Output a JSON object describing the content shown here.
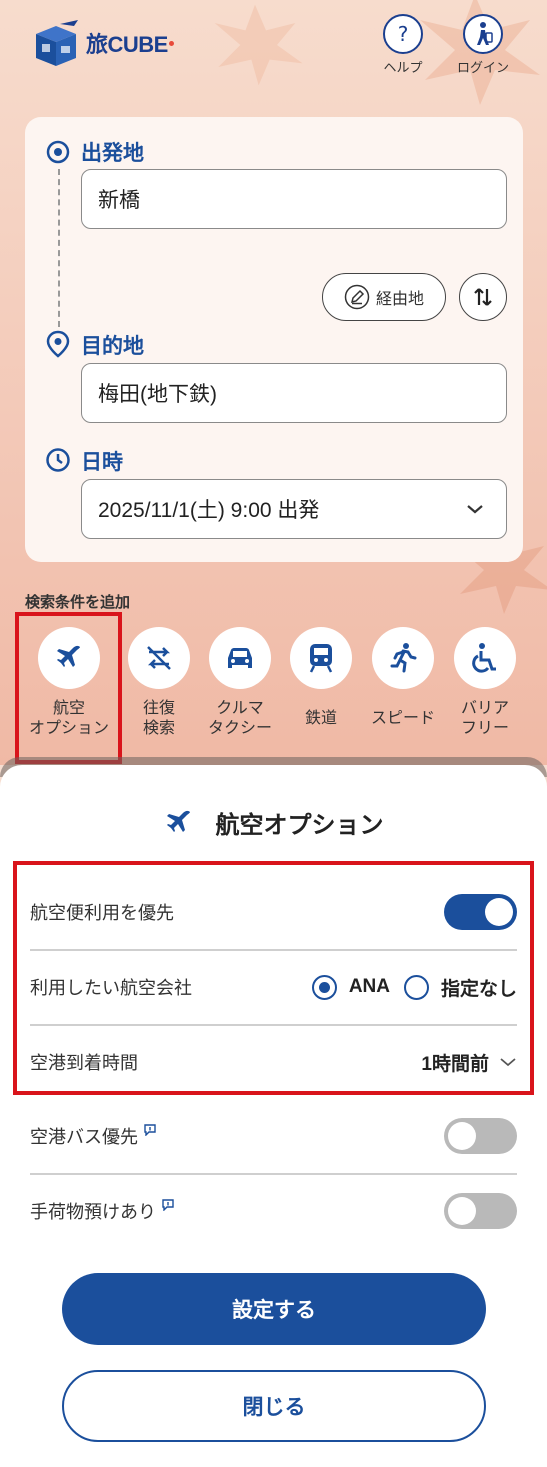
{
  "header": {
    "logo_text": "旅CUBE",
    "help_label": "ヘルプ",
    "login_label": "ログイン"
  },
  "search": {
    "origin_title": "出発地",
    "origin_value": "新橋",
    "via_label": "経由地",
    "destination_title": "目的地",
    "destination_value": "梅田(地下鉄)",
    "datetime_title": "日時",
    "datetime_value": "2025/11/1(土) 9:00 出発"
  },
  "conditions": {
    "title": "検索条件を追加",
    "options": [
      {
        "label": "航空\nオプション",
        "icon": "airplane-icon"
      },
      {
        "label": "往復\n検索",
        "icon": "round-trip-icon"
      },
      {
        "label": "クルマ\nタクシー",
        "icon": "car-icon"
      },
      {
        "label": "鉄道",
        "icon": "train-icon"
      },
      {
        "label": "スピード",
        "icon": "runner-icon"
      },
      {
        "label": "バリア\nフリー",
        "icon": "wheelchair-icon"
      }
    ]
  },
  "sheet": {
    "title": "航空オプション",
    "rows": {
      "prefer_flight": {
        "label": "航空便利用を優先",
        "enabled": true
      },
      "airline": {
        "label": "利用したい航空会社",
        "options": [
          "ANA",
          "指定なし"
        ],
        "selected": "ANA"
      },
      "arrival_time": {
        "label": "空港到着時間",
        "value": "1時間前"
      },
      "airport_bus": {
        "label": "空港バス優先",
        "enabled": false
      },
      "baggage": {
        "label": "手荷物預けあり",
        "enabled": false
      }
    },
    "submit_label": "設定する",
    "close_label": "閉じる"
  },
  "colors": {
    "accent": "#1b4f9c",
    "highlight": "#d9141b",
    "background": "#f6ddd0"
  }
}
